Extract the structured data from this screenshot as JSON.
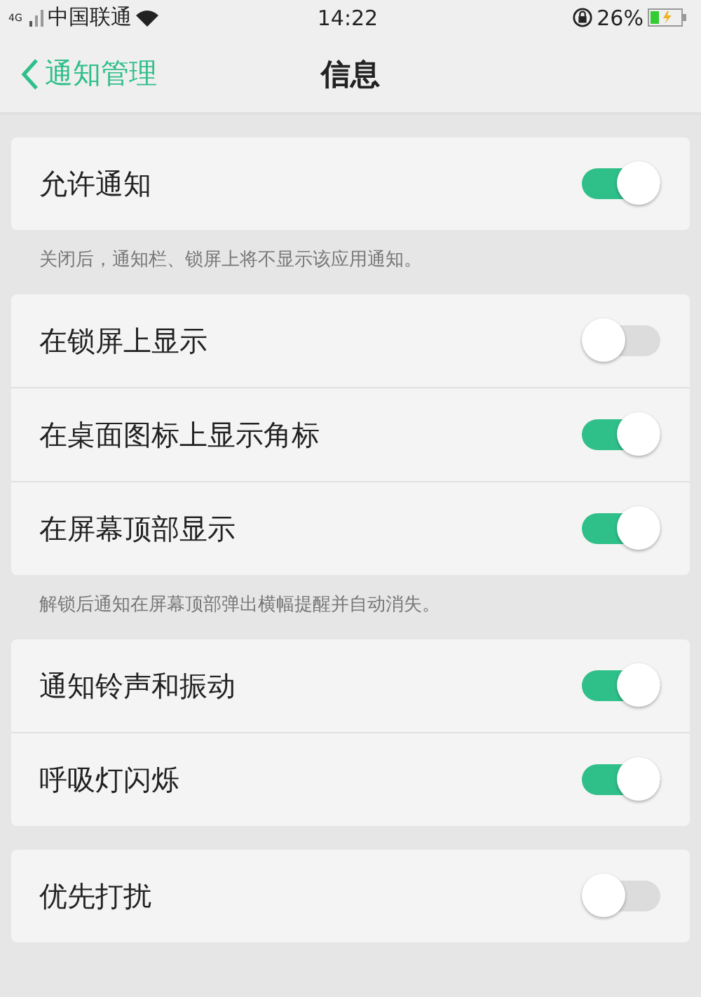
{
  "status_bar": {
    "network": "4G",
    "carrier": "中国联通",
    "time": "14:22",
    "battery": "26%"
  },
  "header": {
    "back": "通知管理",
    "title": "信息"
  },
  "groups": [
    {
      "rows": [
        {
          "label": "允许通知",
          "on": true
        }
      ],
      "note": "关闭后，通知栏、锁屏上将不显示该应用通知。"
    },
    {
      "rows": [
        {
          "label": "在锁屏上显示",
          "on": false
        },
        {
          "label": "在桌面图标上显示角标",
          "on": true
        },
        {
          "label": "在屏幕顶部显示",
          "on": true
        }
      ],
      "note": "解锁后通知在屏幕顶部弹出横幅提醒并自动消失。"
    },
    {
      "rows": [
        {
          "label": "通知铃声和振动",
          "on": true
        },
        {
          "label": "呼吸灯闪烁",
          "on": true
        }
      ]
    },
    {
      "rows": [
        {
          "label": "优先打扰",
          "on": false
        }
      ]
    }
  ]
}
